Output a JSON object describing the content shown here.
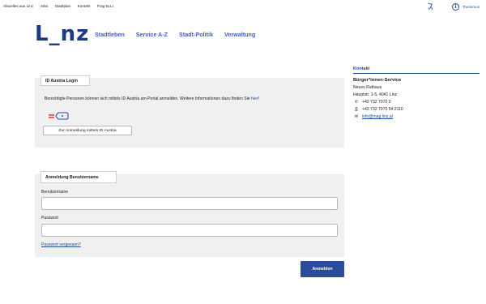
{
  "topnav": {
    "links": [
      "Aktuelles aus Linz",
      "Jobs",
      "Stadtplan",
      "Kontakt",
      "Frag ELLI"
    ],
    "accessibility_icon": "accessibility-icon",
    "tourismus": "Tourismus"
  },
  "header": {
    "logo": "L_nz",
    "nav": [
      "Stadtleben",
      "Service A-Z",
      "Stadt-Politik",
      "Verwaltung"
    ]
  },
  "id_austria": {
    "title": "ID Austria Login",
    "description": "Berechtigte Personen können sich mittels ID Austria am Portal anmelden. Weitere Informationen dazu finden Sie",
    "link": "hier",
    "punct": "!",
    "button": "Zur Anmeldung mittels ID Austria"
  },
  "username_login": {
    "title": "Anmeldung Benutzername",
    "username_label": "Benutzername",
    "username_value": "",
    "password_label": "Passwort",
    "password_value": "",
    "forgot": "Passwort vergessen?",
    "submit": "Anmelden"
  },
  "sidebar": {
    "heading": "Kontakt",
    "title": "Bürger*innen-Service",
    "address1": "Neues Rathaus",
    "address2": "Hauptstr. 1-5, 4041 Linz",
    "phone": "+43 732 7070 0",
    "fax": "+43 732 7070 54 2110",
    "email": "info@mag.linz.at"
  },
  "colors": {
    "brand": "#1a3a8a",
    "link": "#1a4b9b",
    "nav": "#3f61c4",
    "button": "#2a4a9c",
    "panel": "#f0f0f0"
  }
}
